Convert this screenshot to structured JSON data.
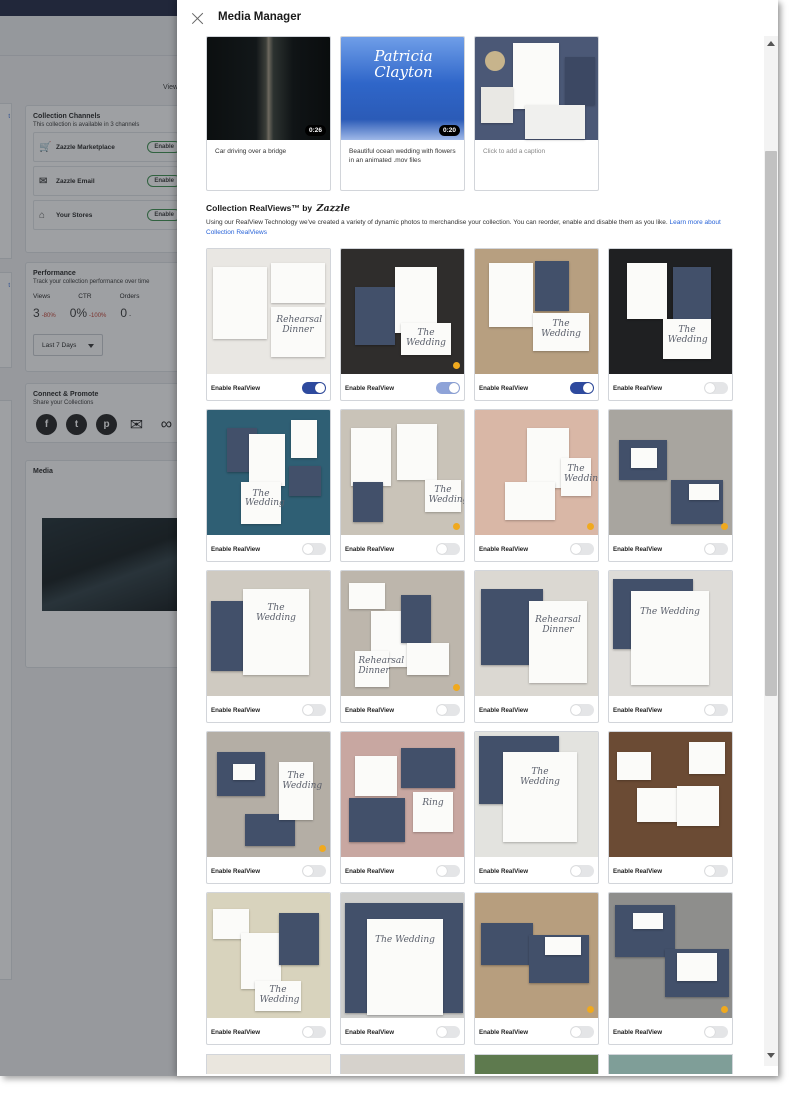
{
  "background": {
    "view_label": "View",
    "channels": {
      "title": "Collection Channels",
      "subtitle": "This collection is available in 3 channels",
      "items": [
        {
          "label": "Zazzle Marketplace",
          "icon": "cart-icon",
          "button": "Enable"
        },
        {
          "label": "Zazzle Email",
          "icon": "mail-icon",
          "button": "Enable"
        },
        {
          "label": "Your Stores",
          "icon": "store-icon",
          "button": "Enable"
        }
      ]
    },
    "performance": {
      "title": "Performance",
      "subtitle": "Track your collection performance over time",
      "metrics": [
        {
          "label": "Views",
          "value": "3",
          "change": "-80%"
        },
        {
          "label": "CTR",
          "value": "0%",
          "change": "-100%"
        },
        {
          "label": "Orders",
          "value": "0",
          "change": "-"
        }
      ],
      "period": "Last 7 Days"
    },
    "connect": {
      "title": "Connect & Promote",
      "subtitle": "Share your Collections",
      "icons": [
        "facebook-icon",
        "twitter-icon",
        "pinterest-icon",
        "email-icon",
        "link-icon"
      ]
    },
    "media": {
      "title": "Media"
    }
  },
  "modal": {
    "title": "Media Manager",
    "videos": [
      {
        "caption": "Car driving over a bridge",
        "duration": "0:26"
      },
      {
        "caption": "Beautiful ocean wedding with flowers in an animated .mov files",
        "duration": "0:20",
        "thumb_title": "Patricia Clayton"
      },
      {
        "caption": "Click to add a caption",
        "duration": ""
      }
    ],
    "realviews": {
      "title": "Collection RealViews™ by",
      "brand": "Zazzle",
      "description": "Using our RealView Technology we've created a variety of dynamic photos to merchandise your collection. You can reorder, enable and disable them as you like.",
      "link_text": "Learn more about Collection RealViews",
      "toggle_label": "Enable RealView",
      "items": [
        {
          "enabled": true,
          "dim": false,
          "badge": false,
          "bg": "#e9e7e3",
          "script": "Rehearsal Dinner"
        },
        {
          "enabled": true,
          "dim": true,
          "badge": true,
          "bg": "#2f2d2c",
          "script": "The Wedding"
        },
        {
          "enabled": true,
          "dim": false,
          "badge": false,
          "bg": "#b79f80",
          "script": "The Wedding"
        },
        {
          "enabled": false,
          "dim": false,
          "badge": false,
          "bg": "#1f2022",
          "script": "The Wedding"
        },
        {
          "enabled": false,
          "dim": false,
          "badge": false,
          "bg": "#2f5f74",
          "script": "The Wedding"
        },
        {
          "enabled": false,
          "dim": false,
          "badge": true,
          "bg": "#c9c3b8",
          "script": "The Wedding"
        },
        {
          "enabled": false,
          "dim": false,
          "badge": true,
          "bg": "#d9b7a6",
          "script": "The Wedding"
        },
        {
          "enabled": false,
          "dim": false,
          "badge": true,
          "bg": "#a8a59f",
          "script": ""
        },
        {
          "enabled": false,
          "dim": false,
          "badge": false,
          "bg": "#cfcac1",
          "script": "The Wedding"
        },
        {
          "enabled": false,
          "dim": false,
          "badge": true,
          "bg": "#bdb6ac",
          "script": "Rehearsal Dinner"
        },
        {
          "enabled": false,
          "dim": false,
          "badge": false,
          "bg": "#dbd8d2",
          "script": "Rehearsal Dinner"
        },
        {
          "enabled": false,
          "dim": false,
          "badge": false,
          "bg": "#dedcd8",
          "script": "The Wedding"
        },
        {
          "enabled": false,
          "dim": false,
          "badge": true,
          "bg": "#b4aea5",
          "script": "The Wedding"
        },
        {
          "enabled": false,
          "dim": false,
          "badge": false,
          "bg": "#c8a7a1",
          "script": "Ring"
        },
        {
          "enabled": false,
          "dim": false,
          "badge": false,
          "bg": "#e3e3df",
          "script": "The Wedding"
        },
        {
          "enabled": false,
          "dim": false,
          "badge": false,
          "bg": "#6b4b34",
          "script": ""
        },
        {
          "enabled": false,
          "dim": false,
          "badge": false,
          "bg": "#d8d3bd",
          "script": "The Wedding"
        },
        {
          "enabled": false,
          "dim": false,
          "badge": false,
          "bg": "#cfcfcd",
          "script": "The Wedding"
        },
        {
          "enabled": false,
          "dim": false,
          "badge": true,
          "bg": "#b79e7e",
          "script": ""
        },
        {
          "enabled": false,
          "dim": false,
          "badge": true,
          "bg": "#8e8e8c",
          "script": ""
        }
      ]
    }
  }
}
